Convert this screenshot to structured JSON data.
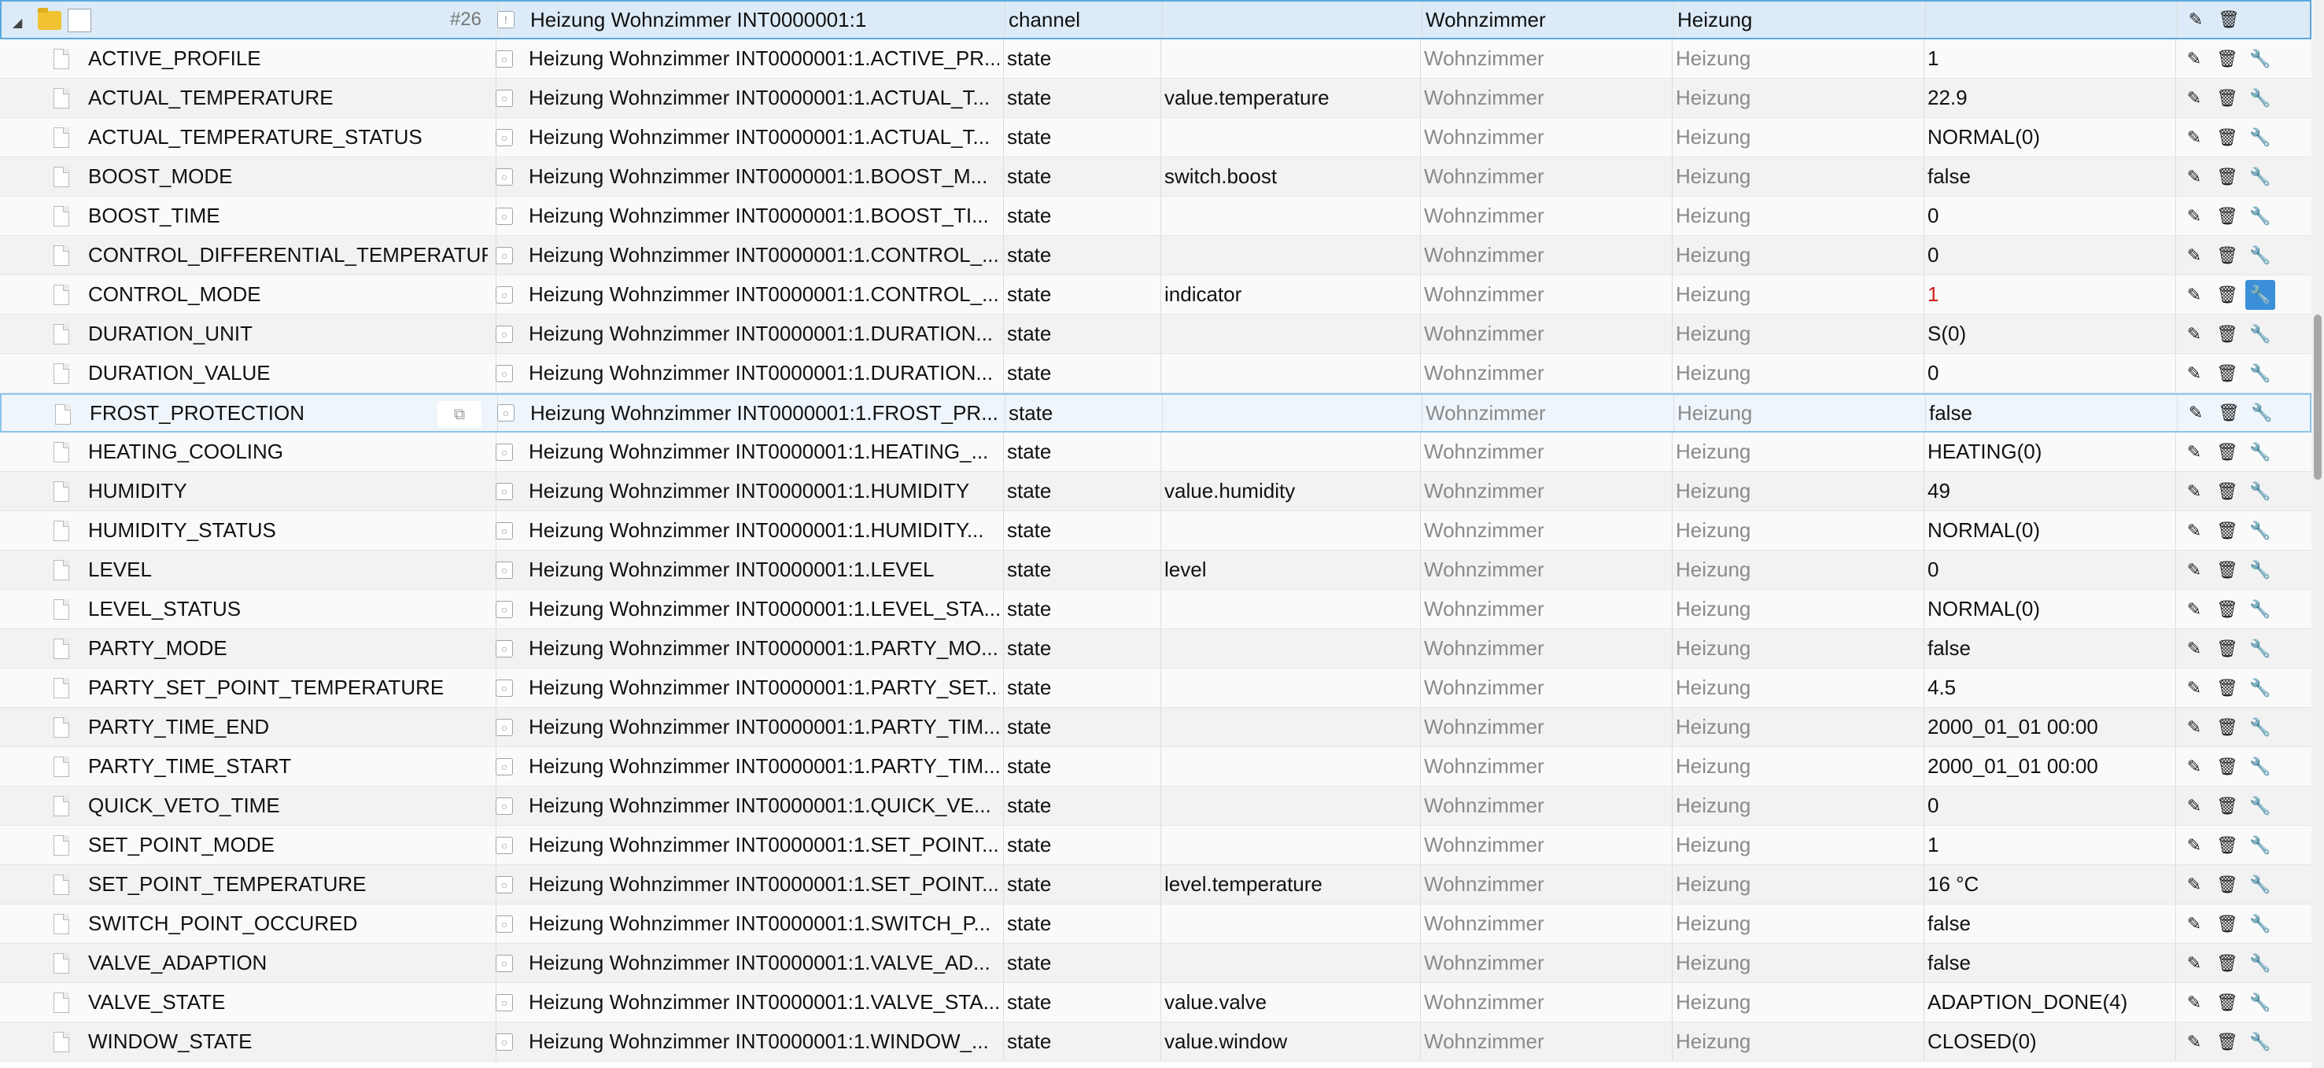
{
  "channel": {
    "count": "#26",
    "name": "Heizung Wohnzimmer INT0000001:1",
    "type": "channel",
    "role": "",
    "room": "Wohnzimmer",
    "function": "Heizung",
    "value": ""
  },
  "rows": [
    {
      "id": "ACTIVE_PROFILE",
      "name": "Heizung Wohnzimmer INT0000001:1.ACTIVE_PR...",
      "type": "state",
      "role": "",
      "room": "Wohnzimmer",
      "function": "Heizung",
      "value": "1"
    },
    {
      "id": "ACTUAL_TEMPERATURE",
      "name": "Heizung Wohnzimmer INT0000001:1.ACTUAL_T...",
      "type": "state",
      "role": "value.temperature",
      "room": "Wohnzimmer",
      "function": "Heizung",
      "value": "22.9"
    },
    {
      "id": "ACTUAL_TEMPERATURE_STATUS",
      "name": "Heizung Wohnzimmer INT0000001:1.ACTUAL_T...",
      "type": "state",
      "role": "",
      "room": "Wohnzimmer",
      "function": "Heizung",
      "value": "NORMAL(0)"
    },
    {
      "id": "BOOST_MODE",
      "name": "Heizung Wohnzimmer INT0000001:1.BOOST_M...",
      "type": "state",
      "role": "switch.boost",
      "room": "Wohnzimmer",
      "function": "Heizung",
      "value": "false"
    },
    {
      "id": "BOOST_TIME",
      "name": "Heizung Wohnzimmer INT0000001:1.BOOST_TI...",
      "type": "state",
      "role": "",
      "room": "Wohnzimmer",
      "function": "Heizung",
      "value": "0"
    },
    {
      "id": "CONTROL_DIFFERENTIAL_TEMPERATURE",
      "name": "Heizung Wohnzimmer INT0000001:1.CONTROL_...",
      "type": "state",
      "role": "",
      "room": "Wohnzimmer",
      "function": "Heizung",
      "value": "0"
    },
    {
      "id": "CONTROL_MODE",
      "name": "Heizung Wohnzimmer INT0000001:1.CONTROL_...",
      "type": "state",
      "role": "indicator",
      "room": "Wohnzimmer",
      "function": "Heizung",
      "value": "1"
    },
    {
      "id": "DURATION_UNIT",
      "name": "Heizung Wohnzimmer INT0000001:1.DURATION...",
      "type": "state",
      "role": "",
      "room": "Wohnzimmer",
      "function": "Heizung",
      "value": "S(0)"
    },
    {
      "id": "DURATION_VALUE",
      "name": "Heizung Wohnzimmer INT0000001:1.DURATION...",
      "type": "state",
      "role": "",
      "room": "Wohnzimmer",
      "function": "Heizung",
      "value": "0"
    },
    {
      "id": "FROST_PROTECTION",
      "name": "Heizung Wohnzimmer INT0000001:1.FROST_PR...",
      "type": "state",
      "role": "",
      "room": "Wohnzimmer",
      "function": "Heizung",
      "value": "false"
    },
    {
      "id": "HEATING_COOLING",
      "name": "Heizung Wohnzimmer INT0000001:1.HEATING_...",
      "type": "state",
      "role": "",
      "room": "Wohnzimmer",
      "function": "Heizung",
      "value": "HEATING(0)"
    },
    {
      "id": "HUMIDITY",
      "name": "Heizung Wohnzimmer INT0000001:1.HUMIDITY",
      "type": "state",
      "role": "value.humidity",
      "room": "Wohnzimmer",
      "function": "Heizung",
      "value": "49"
    },
    {
      "id": "HUMIDITY_STATUS",
      "name": "Heizung Wohnzimmer INT0000001:1.HUMIDITY...",
      "type": "state",
      "role": "",
      "room": "Wohnzimmer",
      "function": "Heizung",
      "value": "NORMAL(0)"
    },
    {
      "id": "LEVEL",
      "name": "Heizung Wohnzimmer INT0000001:1.LEVEL",
      "type": "state",
      "role": "level",
      "room": "Wohnzimmer",
      "function": "Heizung",
      "value": "0"
    },
    {
      "id": "LEVEL_STATUS",
      "name": "Heizung Wohnzimmer INT0000001:1.LEVEL_STA...",
      "type": "state",
      "role": "",
      "room": "Wohnzimmer",
      "function": "Heizung",
      "value": "NORMAL(0)"
    },
    {
      "id": "PARTY_MODE",
      "name": "Heizung Wohnzimmer INT0000001:1.PARTY_MO...",
      "type": "state",
      "role": "",
      "room": "Wohnzimmer",
      "function": "Heizung",
      "value": "false"
    },
    {
      "id": "PARTY_SET_POINT_TEMPERATURE",
      "name": "Heizung Wohnzimmer INT0000001:1.PARTY_SET...",
      "type": "state",
      "role": "",
      "room": "Wohnzimmer",
      "function": "Heizung",
      "value": "4.5"
    },
    {
      "id": "PARTY_TIME_END",
      "name": "Heizung Wohnzimmer INT0000001:1.PARTY_TIM...",
      "type": "state",
      "role": "",
      "room": "Wohnzimmer",
      "function": "Heizung",
      "value": "2000_01_01 00:00"
    },
    {
      "id": "PARTY_TIME_START",
      "name": "Heizung Wohnzimmer INT0000001:1.PARTY_TIM...",
      "type": "state",
      "role": "",
      "room": "Wohnzimmer",
      "function": "Heizung",
      "value": "2000_01_01 00:00"
    },
    {
      "id": "QUICK_VETO_TIME",
      "name": "Heizung Wohnzimmer INT0000001:1.QUICK_VE...",
      "type": "state",
      "role": "",
      "room": "Wohnzimmer",
      "function": "Heizung",
      "value": "0"
    },
    {
      "id": "SET_POINT_MODE",
      "name": "Heizung Wohnzimmer INT0000001:1.SET_POINT...",
      "type": "state",
      "role": "",
      "room": "Wohnzimmer",
      "function": "Heizung",
      "value": "1"
    },
    {
      "id": "SET_POINT_TEMPERATURE",
      "name": "Heizung Wohnzimmer INT0000001:1.SET_POINT...",
      "type": "state",
      "role": "level.temperature",
      "room": "Wohnzimmer",
      "function": "Heizung",
      "value": "16 °C"
    },
    {
      "id": "SWITCH_POINT_OCCURED",
      "name": "Heizung Wohnzimmer INT0000001:1.SWITCH_P...",
      "type": "state",
      "role": "",
      "room": "Wohnzimmer",
      "function": "Heizung",
      "value": "false"
    },
    {
      "id": "VALVE_ADAPTION",
      "name": "Heizung Wohnzimmer INT0000001:1.VALVE_AD...",
      "type": "state",
      "role": "",
      "room": "Wohnzimmer",
      "function": "Heizung",
      "value": "false"
    },
    {
      "id": "VALVE_STATE",
      "name": "Heizung Wohnzimmer INT0000001:1.VALVE_STA...",
      "type": "state",
      "role": "value.valve",
      "room": "Wohnzimmer",
      "function": "Heizung",
      "value": "ADAPTION_DONE(4)"
    },
    {
      "id": "WINDOW_STATE",
      "name": "Heizung Wohnzimmer INT0000001:1.WINDOW_...",
      "type": "state",
      "role": "value.window",
      "room": "Wohnzimmer",
      "function": "Heizung",
      "value": "CLOSED(0)"
    }
  ],
  "highlight": {
    "hovered_row": "FROST_PROTECTION",
    "active_wrench_row": "CONTROL_MODE",
    "red_value_row": "CONTROL_MODE"
  },
  "icons": {
    "edit": "pencil-icon",
    "delete": "trash-icon",
    "settings": "wrench-icon",
    "copy": "copy-icon",
    "channel": "folder-icon",
    "state": "document-icon"
  },
  "colors": {
    "selection": "#dcebf7",
    "accent": "#3b8fd8",
    "alarm_value": "#d21c1c"
  }
}
